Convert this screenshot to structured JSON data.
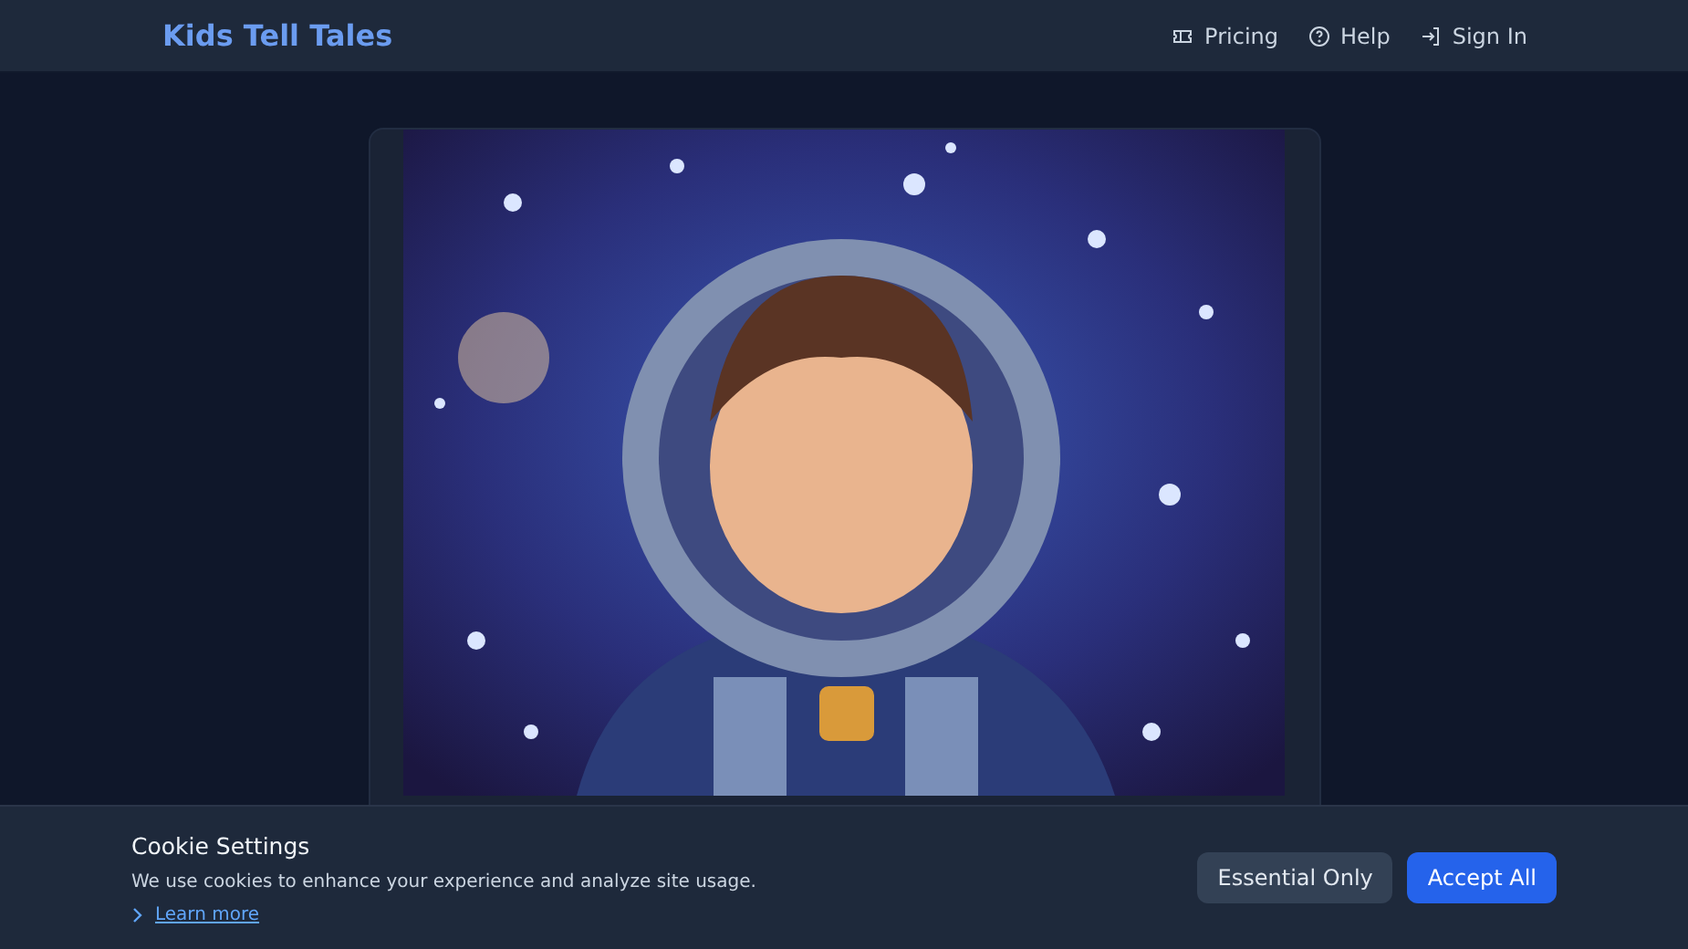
{
  "header": {
    "brand": "Kids Tell Tales",
    "nav": [
      {
        "kind": "pricing",
        "label": "Pricing"
      },
      {
        "kind": "help",
        "label": "Help"
      },
      {
        "kind": "signin",
        "label": "Sign In"
      }
    ]
  },
  "cookie_banner": {
    "title": "Cookie Settings",
    "text": "We use cookies to enhance your experience and analyze site usage.",
    "link": "Learn more",
    "buttons": [
      {
        "kind": "secondary",
        "label": "Essential Only"
      },
      {
        "kind": "primary",
        "label": "Accept All"
      }
    ]
  }
}
